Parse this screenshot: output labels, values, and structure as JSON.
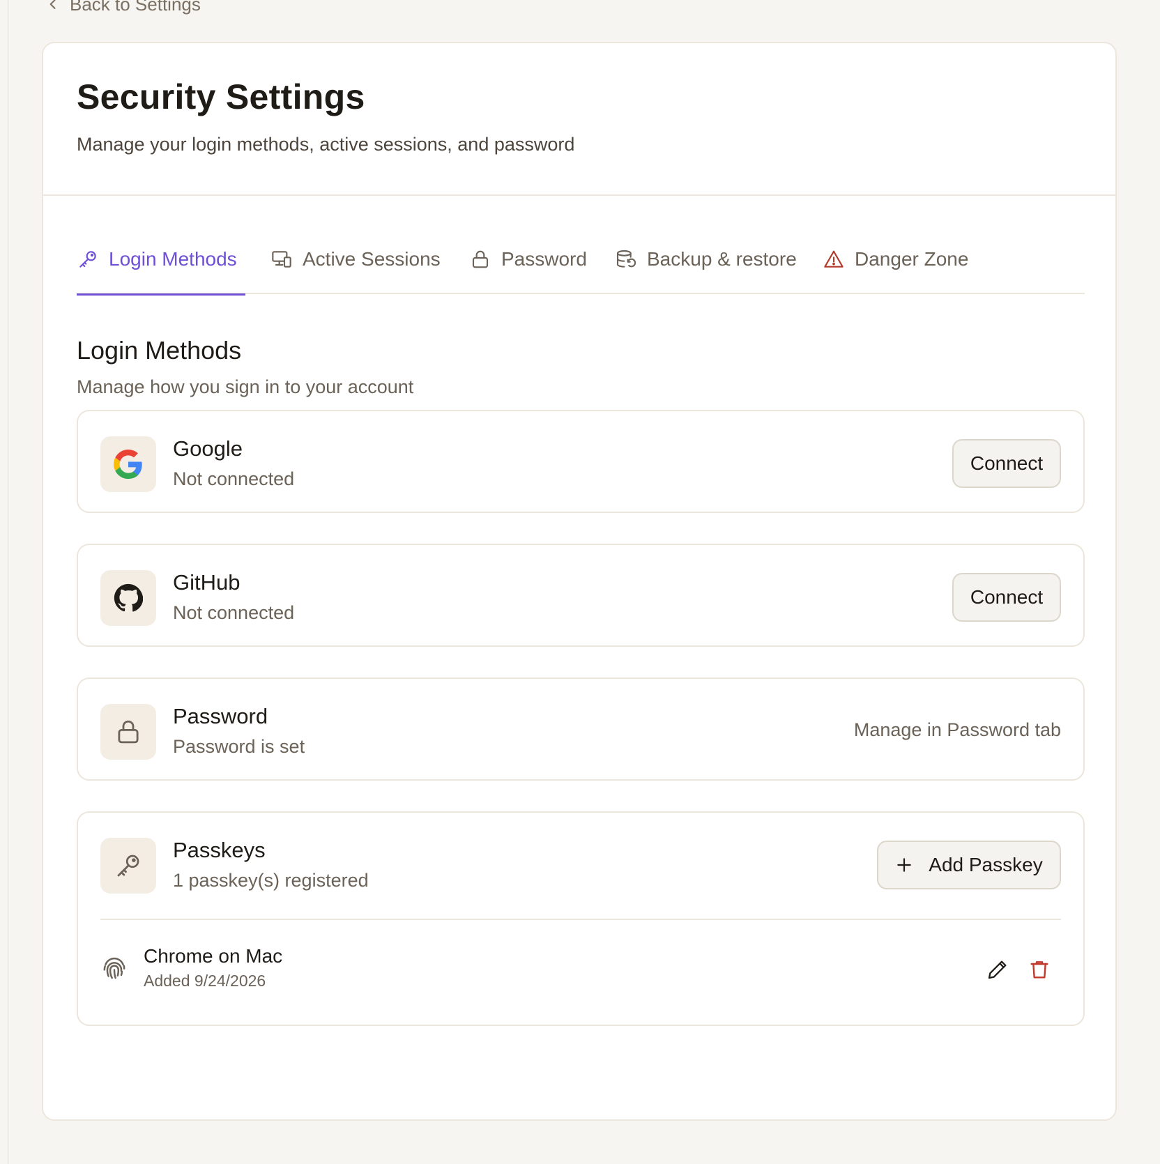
{
  "nav": {
    "back_label": "Back to Settings"
  },
  "header": {
    "title": "Security Settings",
    "subtitle": "Manage your login methods, active sessions, and password"
  },
  "tabs": [
    {
      "label": "Login Methods",
      "icon": "key-icon",
      "active": true
    },
    {
      "label": "Active Sessions",
      "icon": "devices-icon",
      "active": false
    },
    {
      "label": "Password",
      "icon": "lock-icon",
      "active": false
    },
    {
      "label": "Backup & restore",
      "icon": "database-restore-icon",
      "active": false
    },
    {
      "label": "Danger Zone",
      "icon": "warning-icon",
      "active": false
    }
  ],
  "section": {
    "title": "Login Methods",
    "subtitle": "Manage how you sign in to your account"
  },
  "methods": {
    "google": {
      "name": "Google",
      "status": "Not connected",
      "action": "Connect",
      "icon": "google-icon"
    },
    "github": {
      "name": "GitHub",
      "status": "Not connected",
      "action": "Connect",
      "icon": "github-icon"
    },
    "password": {
      "name": "Password",
      "status": "Password is set",
      "note": "Manage in Password tab",
      "icon": "lock-icon"
    },
    "passkeys": {
      "name": "Passkeys",
      "status": "1 passkey(s) registered",
      "action": "Add Passkey",
      "icon": "key-icon",
      "items": [
        {
          "name": "Chrome on Mac",
          "added": "Added 9/24/2026",
          "icon": "fingerprint-icon"
        }
      ]
    }
  },
  "colors": {
    "accent": "#6e4fd6",
    "danger": "#b23a2b",
    "background": "#f7f5f1",
    "card": "#ffffff",
    "icon_tile": "#f3ede4",
    "border": "#ece6dc"
  }
}
